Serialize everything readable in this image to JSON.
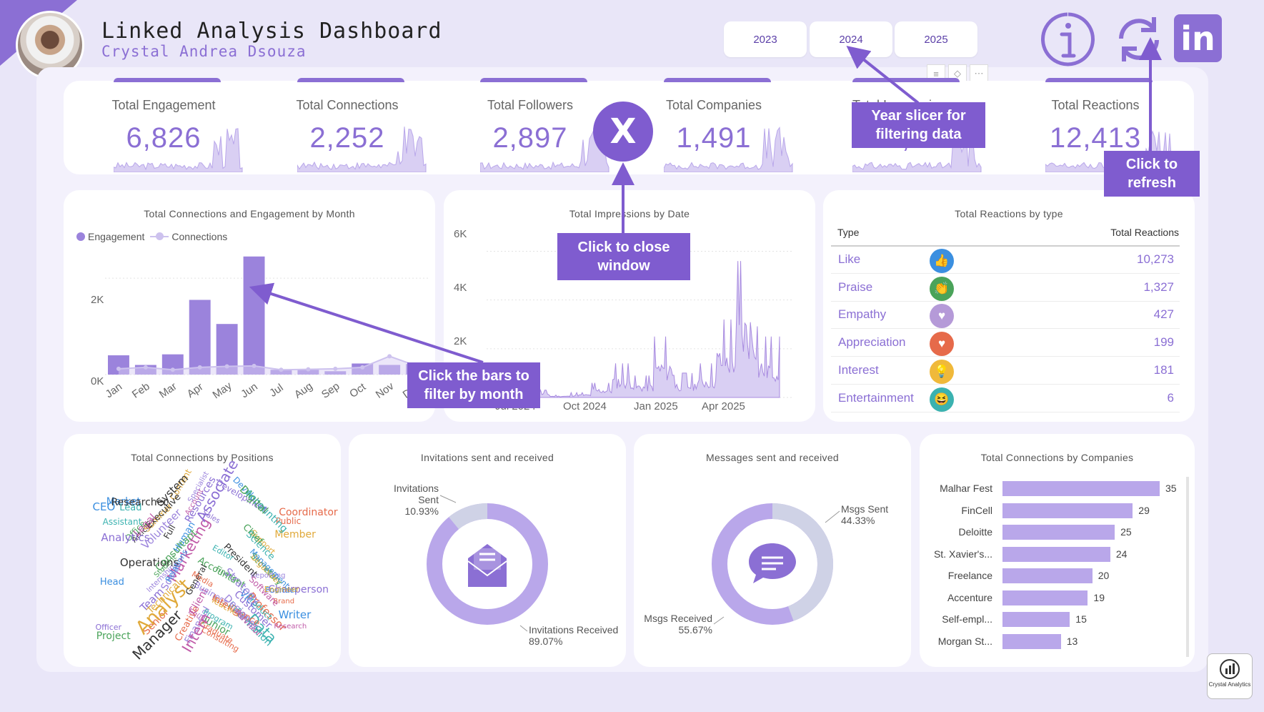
{
  "header": {
    "title": "Linked Analysis Dashboard",
    "subtitle": "Crystal Andrea Dsouza"
  },
  "years": [
    "2023",
    "2024",
    "2025"
  ],
  "kpis": [
    {
      "label": "Total Engagement",
      "value": "6,826"
    },
    {
      "label": "Total Connections",
      "value": "2,252"
    },
    {
      "label": "Total Followers",
      "value": "2,897"
    },
    {
      "label": "Total Companies",
      "value": "1,491"
    },
    {
      "label": "Total Impressions",
      "value": "25,..."
    },
    {
      "label": "Total Reactions",
      "value": "12,413"
    }
  ],
  "callouts": {
    "year": "Year slicer for filtering data",
    "refresh": "Click to refresh",
    "close": "Click to close window",
    "bars": "Click the bars to filter by month",
    "close_symbol": "X"
  },
  "month_chart": {
    "title": "Total Connections and Engagement by Month",
    "legend": [
      "Engagement",
      "Connections"
    ],
    "yticks": [
      "0K",
      "2K"
    ]
  },
  "impressions_chart": {
    "title": "Total Impressions by Date",
    "yticks": [
      "6K",
      "4K",
      "2K"
    ],
    "xticks": [
      "Jul 2024",
      "Oct 2024",
      "Jan 2025",
      "Apr 2025"
    ]
  },
  "reactions": {
    "title": "Total Reactions by type",
    "col_type": "Type",
    "col_value": "Total Reactions",
    "rows": [
      {
        "type": "Like",
        "value": "10,273",
        "icon": "thumbs-up-icon",
        "color": "#3b8fe0",
        "glyph": "👍"
      },
      {
        "type": "Praise",
        "value": "1,327",
        "icon": "clapping-hands-icon",
        "color": "#4aa35a",
        "glyph": "👏"
      },
      {
        "type": "Empathy",
        "value": "427",
        "icon": "heart-hand-icon",
        "color": "#b59ad8",
        "glyph": "♥"
      },
      {
        "type": "Appreciation",
        "value": "199",
        "icon": "heart-icon",
        "color": "#e66a4a",
        "glyph": "♥"
      },
      {
        "type": "Interest",
        "value": "181",
        "icon": "lightbulb-icon",
        "color": "#f0b93a",
        "glyph": "💡"
      },
      {
        "type": "Entertainment",
        "value": "6",
        "icon": "laughing-face-icon",
        "color": "#3bb2b0",
        "glyph": "😆"
      }
    ]
  },
  "positions": {
    "title": "Total Connections by Positions"
  },
  "words": [
    "Creative",
    "Secretary",
    "CEO",
    "Resources",
    "Equity",
    "Teacher",
    "Article",
    "Information",
    "Financial",
    "Brand",
    "Junior",
    "Vice",
    "Chairperson",
    "Account",
    "Organizer",
    "Full",
    "Program",
    "Reporting",
    "Graduate",
    "Office",
    "Market",
    "Customer",
    "Client",
    "Support",
    "Researcher",
    "Science",
    "Internship",
    "Coordinator",
    "Student",
    "Developer",
    "Sales",
    "Marketing",
    "Content",
    "Operations",
    "Assistant",
    "Business",
    "Public",
    "Chief",
    "Human",
    "Team",
    "Advisor",
    "Summer",
    "Executive",
    "Lead",
    "Social",
    "Senior",
    "Consultant",
    "Founder",
    "Associate",
    "Intern",
    "Analyst",
    "Manager",
    "Data",
    "Specialist",
    "Intelligence",
    "Finance",
    "Writer",
    "Officer",
    "Legal",
    "Member",
    "President",
    "Accounting",
    "Designer",
    "Professor",
    "Accountant",
    "Relations",
    "Development",
    "Software",
    "Technical",
    "General",
    "Product",
    "Strategy",
    "Media",
    "Digital",
    "Management",
    "Analytics",
    "Research",
    "Engineer",
    "System",
    "Editor",
    "Volunteer",
    "Consulting",
    "Project",
    "Head"
  ],
  "invitations": {
    "title": "Invitations sent and received",
    "sent_label": "Invitations Sent",
    "sent_pct": "10.93%",
    "recv_label": "Invitations Received",
    "recv_pct": "89.07%",
    "sent_fraction": 0.1093
  },
  "messages": {
    "title": "Messages sent and received",
    "sent_label": "Msgs Sent",
    "sent_pct": "44.33%",
    "recv_label": "Msgs Received",
    "recv_pct": "55.67%",
    "sent_fraction": 0.4433
  },
  "companies": {
    "title": "Total Connections by Companies"
  },
  "logo_text": "Crystal Analytics",
  "chart_data": [
    {
      "type": "bar",
      "title": "Total Connections and Engagement by Month",
      "categories": [
        "Jan",
        "Feb",
        "Mar",
        "Apr",
        "May",
        "Jun",
        "Jul",
        "Aug",
        "Sep",
        "Oct",
        "Nov",
        "Dec"
      ],
      "series": [
        {
          "name": "Engagement",
          "values": [
            400,
            200,
            420,
            1550,
            1050,
            2450,
            100,
            100,
            70,
            230,
            200,
            220
          ]
        },
        {
          "name": "Connections",
          "values": [
            120,
            150,
            100,
            150,
            170,
            180,
            100,
            110,
            120,
            150,
            380,
            180
          ]
        }
      ],
      "yticks": [
        "0K",
        "2K"
      ],
      "ylim": [
        0,
        2800
      ]
    },
    {
      "type": "area",
      "title": "Total Impressions by Date",
      "x": [
        "Jul 2024",
        "Aug 2024",
        "Sep 2024",
        "Oct 2024",
        "Nov 2024",
        "Dec 2024",
        "Jan 2025",
        "Feb 2025",
        "Mar 2025",
        "Apr 2025",
        "May 2025",
        "Jun 2025"
      ],
      "values": [
        300,
        100,
        200,
        600,
        1400,
        900,
        2500,
        1000,
        1400,
        3200,
        5600,
        2500
      ],
      "ylim": [
        0,
        6600
      ]
    },
    {
      "type": "bar",
      "title": "Total Connections by Companies",
      "categories": [
        "Malhar Fest",
        "FinCell",
        "Deloitte",
        "St. Xavier's...",
        "Freelance",
        "Accenture",
        "Self-empl...",
        "Morgan St..."
      ],
      "values": [
        35,
        29,
        25,
        24,
        20,
        19,
        15,
        13
      ]
    }
  ]
}
